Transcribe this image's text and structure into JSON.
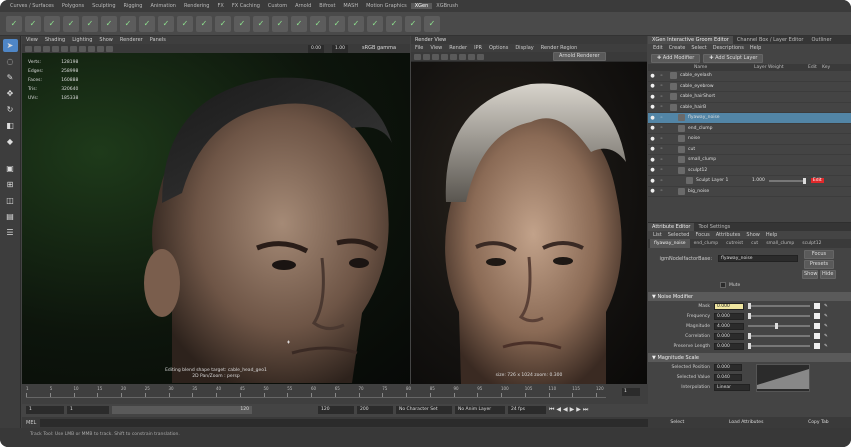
{
  "shelf_tabs": [
    "Curves / Surfaces",
    "Polygons",
    "Sculpting",
    "Rigging",
    "Animation",
    "Rendering",
    "FX",
    "FX Caching",
    "Custom",
    "Arnold",
    "Bifrost",
    "MASH",
    "Motion Graphics",
    "XGen",
    "XGBrush"
  ],
  "active_shelf": "XGen",
  "viewport": {
    "menu": [
      "View",
      "Shading",
      "Lighting",
      "Show",
      "Renderer",
      "Panels"
    ],
    "field_a": "0.00",
    "field_b": "1.00",
    "colorspace": "sRGB gamma",
    "hud": [
      [
        "Verts:",
        "128198"
      ],
      [
        "Edges:",
        "258998"
      ],
      [
        "Faces:",
        "160888"
      ],
      [
        "Tris:",
        "320640"
      ],
      [
        "UVs:",
        "185338"
      ]
    ],
    "caption_line1": "Editing blend shape target: cable_head_geo1",
    "caption_line2": "2D Pan/Zoom : persp"
  },
  "render_view": {
    "title": "Render View",
    "menu": [
      "File",
      "View",
      "Render",
      "IPR",
      "Options",
      "Display",
      "Render Region"
    ],
    "snapshot_label": "Arnold Renderer",
    "caption": "size: 726 x 1024  zoom: 0.300"
  },
  "xgen": {
    "tabs": [
      "XGen Interactive Groom Editor",
      "Channel Box / Layer Editor",
      "Outliner"
    ],
    "menu": [
      "Edit",
      "Create",
      "Select",
      "Descriptions",
      "Help"
    ],
    "add_modifier": "Add Modifier",
    "add_sculpt_layer": "Add Sculpt Layer",
    "columns": [
      "Name",
      "Layer Weight",
      "Edit",
      "Key"
    ],
    "rows": [
      {
        "name": "cable_eyelash",
        "indent": 0,
        "selected": false
      },
      {
        "name": "cable_eyebrow",
        "indent": 0,
        "selected": false
      },
      {
        "name": "cable_hairShort",
        "indent": 0,
        "selected": false
      },
      {
        "name": "cable_hairB",
        "indent": 0,
        "selected": false
      },
      {
        "name": "flyaway_noise",
        "indent": 1,
        "selected": true
      },
      {
        "name": "end_clump",
        "indent": 1,
        "selected": false
      },
      {
        "name": "noise",
        "indent": 1,
        "selected": false
      },
      {
        "name": "cut",
        "indent": 1,
        "selected": false
      },
      {
        "name": "small_clump",
        "indent": 1,
        "selected": false
      },
      {
        "name": "sculpt12",
        "indent": 1,
        "selected": false
      },
      {
        "name": "Sculpt Layer 1",
        "indent": 2,
        "selected": false
      },
      {
        "name": "big_noise",
        "indent": 1,
        "selected": false
      }
    ],
    "layer_weight": "1.000",
    "edit_label": "Edit"
  },
  "attribute_editor": {
    "tabs": [
      "Attribute Editor",
      "Tool Settings"
    ],
    "menu": [
      "List",
      "Selected",
      "Focus",
      "Attributes",
      "Show",
      "Help"
    ],
    "node_tabs": [
      "flyaway_noise",
      "end_clump",
      "cutreist",
      "cut",
      "small_clump",
      "sculpt12"
    ],
    "node_label": "igmNodeIfactorBase:",
    "node_value": "flyaway_noise",
    "focus": "Focus",
    "presets": "Presets",
    "show": "Show",
    "hide": "Hide",
    "mute": "Mute",
    "section1": "Noise Modifier",
    "attrs": [
      {
        "label": "Mask",
        "value": "0.000",
        "fill": 0.0
      },
      {
        "label": "Frequency",
        "value": "0.000",
        "fill": 0.0
      },
      {
        "label": "Magnitude",
        "value": "4.000",
        "fill": 0.45
      },
      {
        "label": "Correlation",
        "value": "0.000",
        "fill": 0.0
      },
      {
        "label": "Preserve Length",
        "value": "0.000",
        "fill": 0.0
      }
    ],
    "section2": "Magnitude Scale",
    "sel_position_label": "Selected Position",
    "sel_position": "0.000",
    "sel_value_label": "Selected Value",
    "sel_value": "0.040",
    "interp_label": "Interpolation",
    "interp": "Linear",
    "select": "Select",
    "load": "Load Attributes",
    "copy": "Copy Tab"
  },
  "timeline": {
    "tick_labels": [
      "1",
      "5",
      "10",
      "15",
      "20",
      "25",
      "30",
      "35",
      "40",
      "45",
      "50",
      "55",
      "60",
      "65",
      "70",
      "75",
      "80",
      "85",
      "90",
      "95",
      "100",
      "105",
      "110",
      "115",
      "120"
    ],
    "current_frame": "1",
    "start": "1",
    "range_start": "1",
    "range_end": "120",
    "end": "120",
    "end2": "200",
    "char_set": "No Character Set",
    "anim_layer": "No Anim Layer",
    "fps": "24 fps"
  },
  "command_line": {
    "lang": "MEL"
  },
  "help_line": "Track Tool: Use LMB or MMB to track. Shift to constrain translation."
}
